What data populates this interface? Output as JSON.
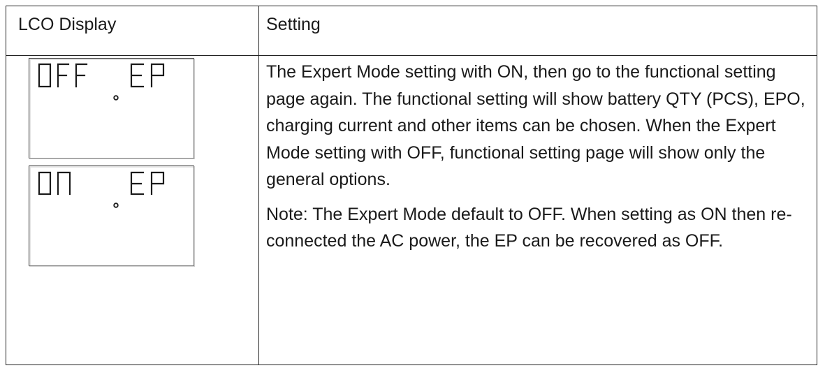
{
  "table": {
    "header": {
      "lcd_column": "LCO Display",
      "setting_column": "Setting"
    },
    "lcd_panels": [
      {
        "left_text": "OFF",
        "right_text": "EP",
        "icon": "lcd-off-ep"
      },
      {
        "left_text": "ON",
        "right_text": "EP",
        "icon": "lcd-on-ep"
      }
    ],
    "setting_paragraphs": [
      "The Expert Mode setting with ON, then go to the functional setting page again. The functional setting will show battery QTY (PCS), EPO, charging current and other items can be chosen. When the Expert Mode setting with OFF, functional setting page will show only the general options.",
      "Note: The Expert Mode default to OFF. When setting as ON then re-connected the AC power, the EP can be recovered as OFF."
    ]
  }
}
